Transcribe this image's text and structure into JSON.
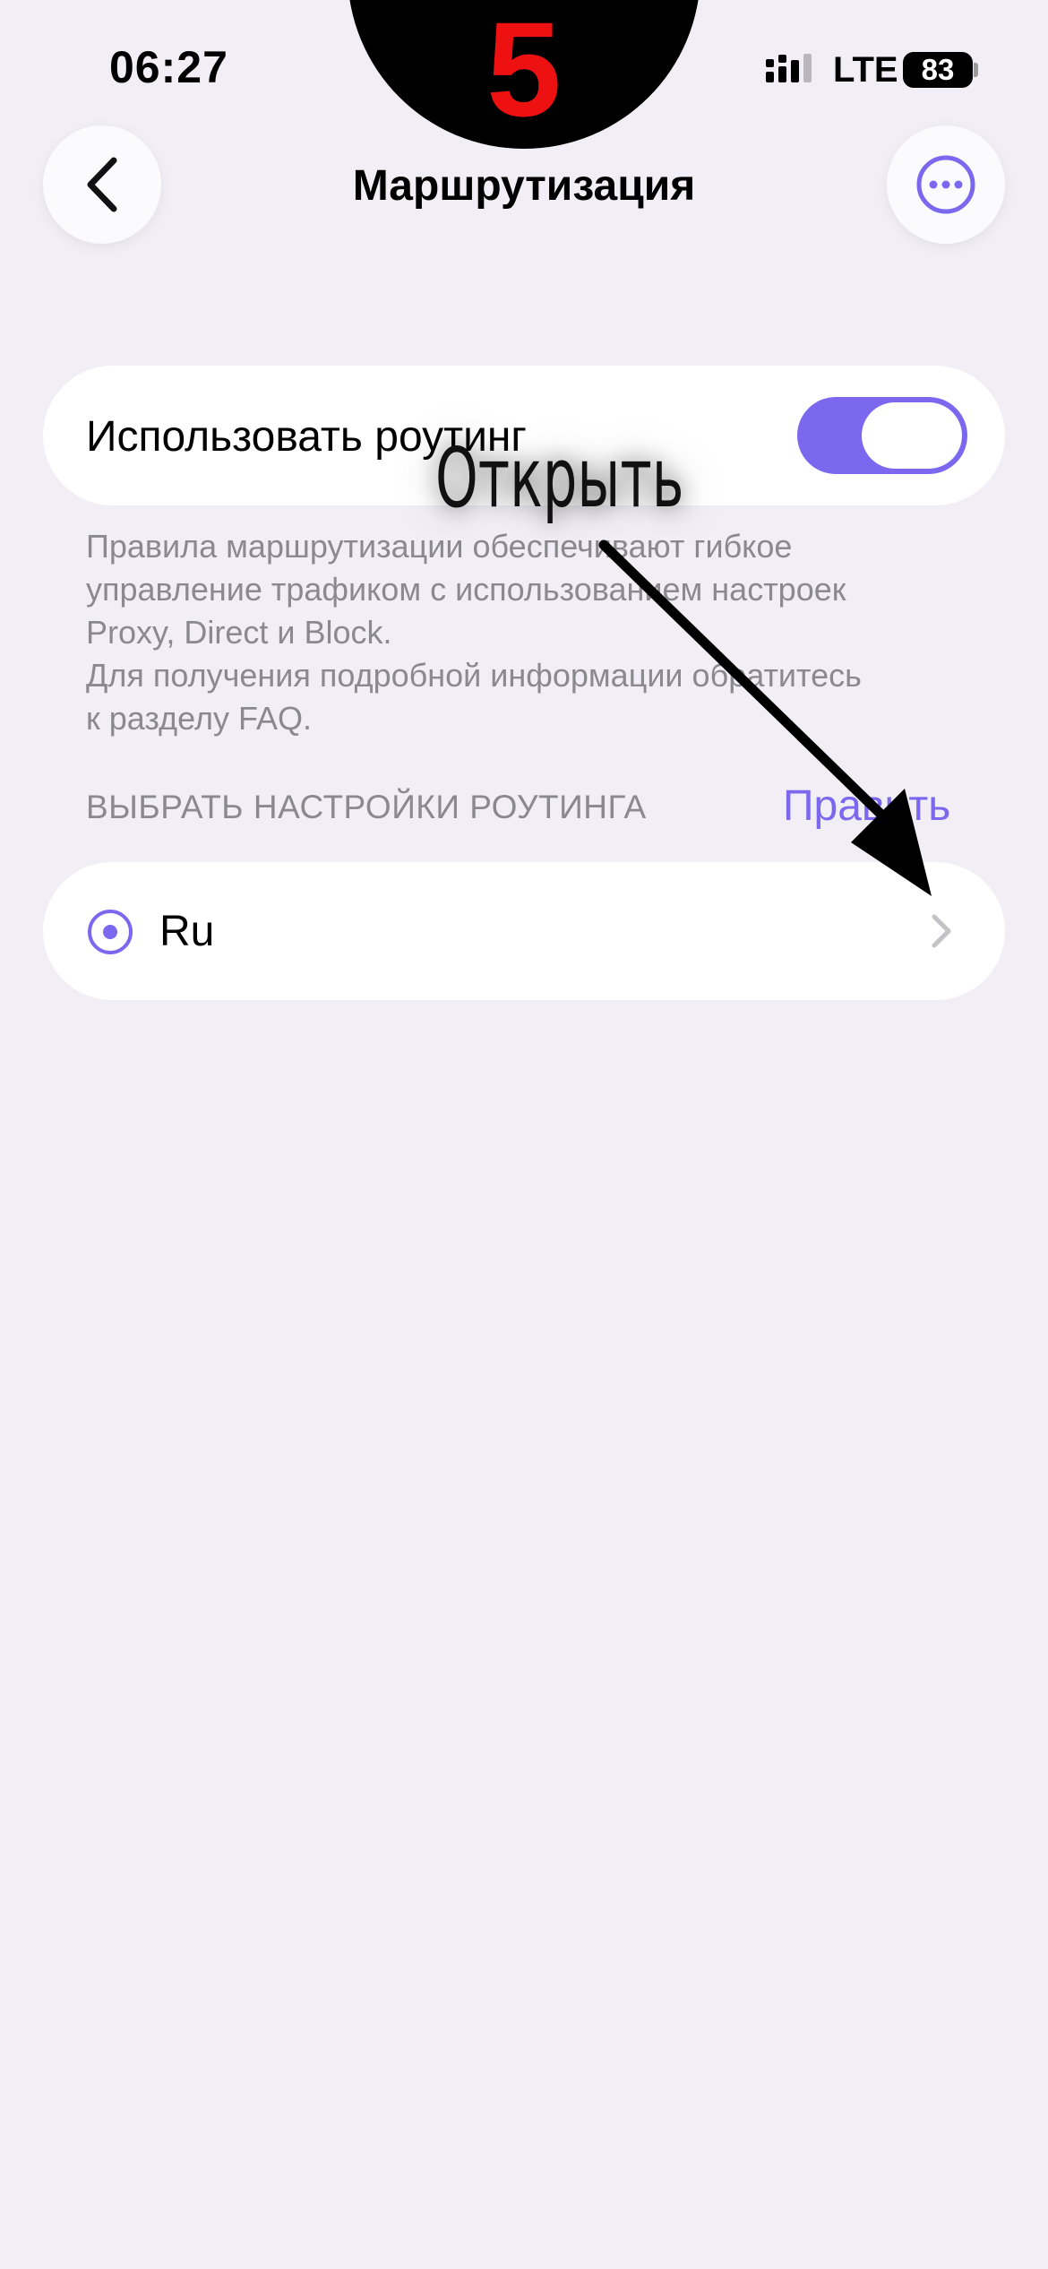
{
  "status_bar": {
    "time": "06:27",
    "network": "LTE",
    "battery": "83"
  },
  "overlay": {
    "step_number": "5",
    "annotation": "Открыть"
  },
  "header": {
    "title": "Маршрутизация",
    "back_icon": "chevron-left-icon",
    "more_icon": "ellipsis-circle-icon"
  },
  "routing_toggle": {
    "label": "Использовать роутинг",
    "enabled": true
  },
  "description": "Правила маршрутизации обеспечивают гибкое\nуправление трафиком с использованием настроек\nProxy, Direct и Block.\nДля получения подробной информации обратитесь\nк разделу FAQ.",
  "routing_section": {
    "header": "ВЫБРАТЬ НАСТРОЙКИ РОУТИНГА",
    "edit_label": "Править",
    "items": [
      {
        "name": "Ru",
        "selected": true
      }
    ]
  },
  "colors": {
    "accent": "#7b68ee",
    "background": "#f1eff5",
    "secondary_text": "#8a8a8e",
    "step_number": "#ee1111"
  }
}
